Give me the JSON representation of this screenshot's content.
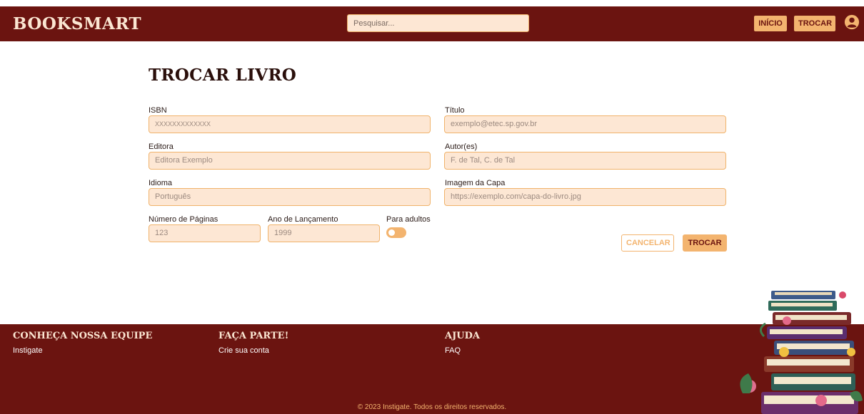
{
  "header": {
    "brand": "BOOKSMART",
    "search_placeholder": "Pesquisar...",
    "nav": [
      "INÍCIO",
      "TROCAR"
    ],
    "user_icon": "user-circle-icon"
  },
  "form": {
    "title": "TROCAR LIVRO",
    "fields": {
      "isbn": {
        "label": "ISBN",
        "placeholder": "XXXXXXXXXXXXX"
      },
      "titulo": {
        "label": "Título",
        "placeholder": "exemplo@etec.sp.gov.br"
      },
      "editora": {
        "label": "Editora",
        "placeholder": "Editora Exemplo"
      },
      "autores": {
        "label": "Autor(es)",
        "placeholder": "F. de Tal, C. de Tal"
      },
      "idioma": {
        "label": "Idioma",
        "placeholder": "Português"
      },
      "capa": {
        "label": "Imagem da Capa",
        "placeholder": "https://exemplo.com/capa-do-livro.jpg"
      },
      "paginas": {
        "label": "Número de Páginas",
        "placeholder": "123"
      },
      "ano": {
        "label": "Ano de Lançamento",
        "placeholder": "1999"
      }
    },
    "adultos": {
      "label": "Para adultos",
      "checked": false
    },
    "buttons": {
      "cancel": "CANCELAR",
      "submit": "TROCAR"
    }
  },
  "footer": {
    "columns": [
      {
        "heading": "CONHEÇA NOSSA EQUIPE",
        "link": "Instigate"
      },
      {
        "heading": "FAÇA PARTE!",
        "link": "Crie sua conta"
      },
      {
        "heading": "AJUDA",
        "link": "FAQ"
      }
    ],
    "copyright": "© 2023 Instigate. Todos os direitos reservados."
  },
  "colors": {
    "primary": "#6b1410",
    "accent": "#f3b46f",
    "field_bg": "#fde7d4"
  }
}
